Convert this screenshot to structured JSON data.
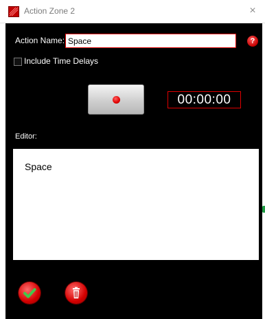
{
  "window": {
    "title": "Action Zone 2",
    "close_glyph": "×",
    "app_icon": "app-logo-icon",
    "close_icon": "close-icon"
  },
  "form": {
    "action_name_label": "Action Name:",
    "action_name_value": "Space",
    "help_glyph": "?",
    "include_time_delays_label": "Include Time Delays",
    "include_time_delays_checked": false,
    "timer": "00:00:00",
    "editor_label": "Editor:",
    "editor_text": "Space"
  },
  "buttons": {
    "record_icon": "record-icon",
    "save_icon": "checkmark-icon",
    "delete_icon": "trash-icon"
  },
  "colors": {
    "dialog_bg": "#000000",
    "accent_red": "#e00000",
    "check_green": "#43c84a"
  }
}
